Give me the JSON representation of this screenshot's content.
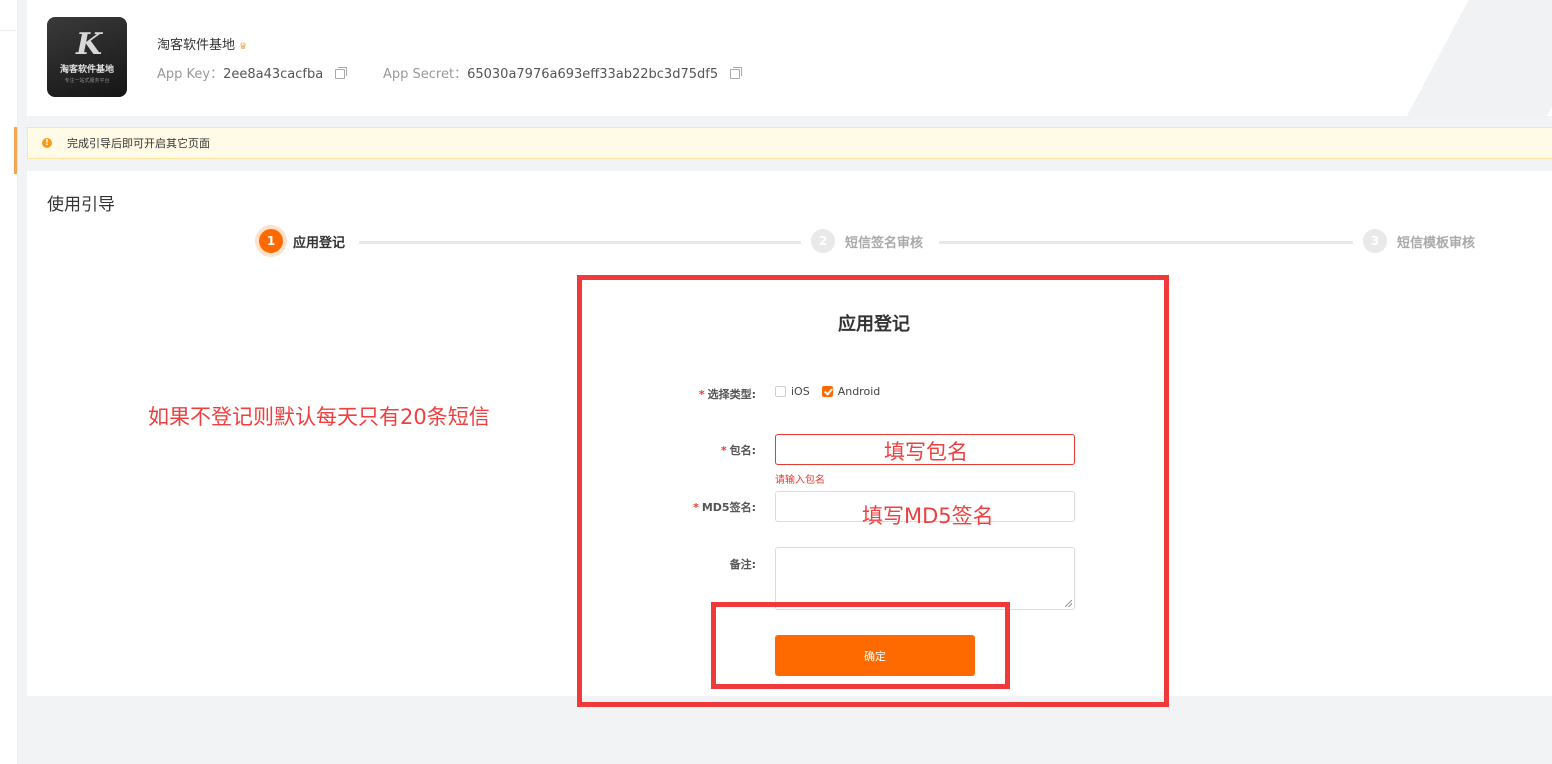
{
  "app": {
    "name": "淘客软件基地",
    "crown_icon": "crown-icon",
    "logo": {
      "mark": "K",
      "text": "淘客软件基地",
      "sub": "专注一站式服务平台"
    },
    "app_key_label": "App Key：",
    "app_key_value": "2ee8a43cacfba",
    "app_secret_label": "App Secret：",
    "app_secret_value": "65030a7976a693eff33ab22bc3d75df5"
  },
  "notice": {
    "icon": "warning-icon",
    "text": "完成引导后即可开启其它页面",
    "color": "#fa9b14"
  },
  "guide": {
    "title": "使用引导",
    "steps": [
      {
        "number": "1",
        "label": "应用登记",
        "state": "active"
      },
      {
        "number": "2",
        "label": "短信签名审核",
        "state": "inactive"
      },
      {
        "number": "3",
        "label": "短信模板审核",
        "state": "inactive"
      }
    ]
  },
  "form": {
    "title": "应用登记",
    "type_label": "选择类型:",
    "options": [
      {
        "label": "iOS",
        "checked": false
      },
      {
        "label": "Android",
        "checked": true
      }
    ],
    "package_label": "包名:",
    "package_error": "请输入包名",
    "md5_label": "MD5签名:",
    "remark_label": "备注:",
    "submit_label": "确定"
  },
  "annotations": {
    "left_note": "如果不登记则默认每天只有20条短信",
    "package_hint": "填写包名",
    "md5_hint": "填写MD5签名",
    "color": "#f0393a"
  },
  "colors": {
    "accent": "#ff6a00",
    "error": "#e8382f",
    "notice_bg": "#fffbe6"
  }
}
